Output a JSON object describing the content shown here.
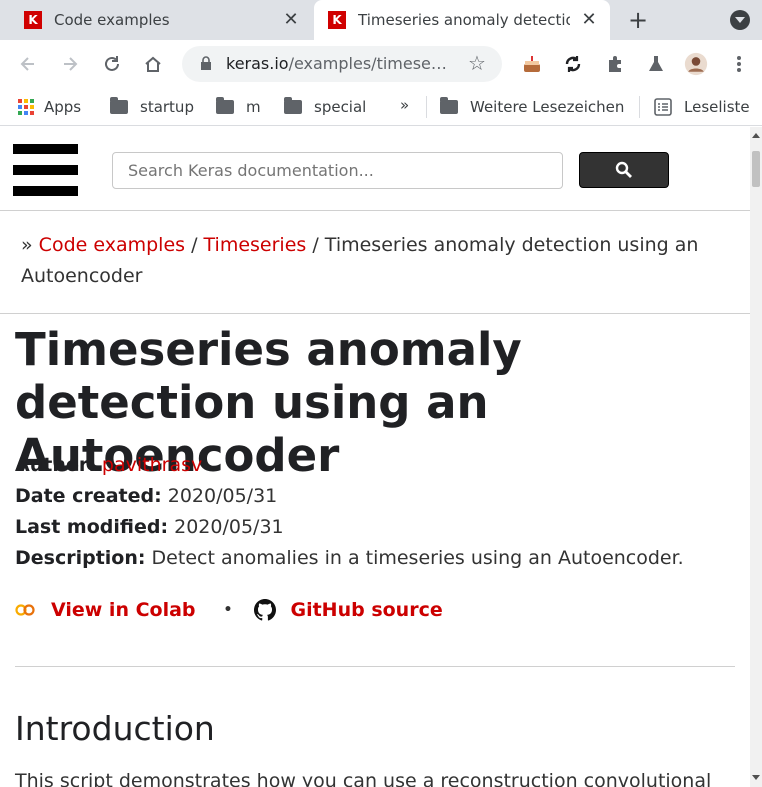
{
  "browser": {
    "tabs": [
      {
        "title": "Code examples",
        "favicon": "K"
      },
      {
        "title": "Timeseries anomaly detection using an Autoencoder",
        "favicon": "K",
        "active": true
      }
    ],
    "address": {
      "host": "keras.io",
      "path": "/examples/timese…"
    },
    "bookmarks": [
      {
        "label": "Apps"
      },
      {
        "label": "startup"
      },
      {
        "label": "m"
      },
      {
        "label": "special"
      },
      {
        "label": "»"
      },
      {
        "label": "Weitere Lesezeichen"
      },
      {
        "label": "Leseliste"
      }
    ],
    "accent_color": "#d00000"
  },
  "site": {
    "search_placeholder": "Search Keras documentation...",
    "breadcrumb": {
      "prefix": "»",
      "links": [
        "Code examples",
        "Timeseries"
      ],
      "separator": "/",
      "current": "Timeseries anomaly detection using an Autoencoder"
    },
    "title": "Timeseries anomaly detection using an Autoencoder",
    "meta": {
      "author_label": "Author:",
      "author": "pavithrasv",
      "created_label": "Date created:",
      "created": "2020/05/31",
      "modified_label": "Last modified:",
      "modified": "2020/05/31",
      "description_label": "Description:",
      "description": "Detect anomalies in a timeseries using an Autoencoder."
    },
    "links": {
      "colab": "View in Colab",
      "bullet": "•",
      "github": "GitHub source"
    },
    "intro_heading": "Introduction",
    "intro_text": "This script demonstrates how you can use a reconstruction convolutional"
  }
}
